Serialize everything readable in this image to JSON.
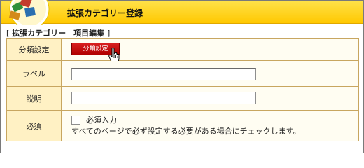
{
  "header": {
    "title": "拡張カテゴリー登録"
  },
  "section": {
    "title": "拡張カテゴリー　項目編集",
    "open_bracket": "[",
    "close_bracket": "]"
  },
  "form": {
    "category": {
      "label": "分類設定",
      "button_label": "分類設定"
    },
    "label_field": {
      "label": "ラベル",
      "value": ""
    },
    "description_field": {
      "label": "説明",
      "value": ""
    },
    "required": {
      "label": "必須",
      "checkbox_label": "必須入力",
      "checked": false,
      "description": "すべてのページで必ず設定する必要がある場合にチェックします。"
    }
  },
  "colors": {
    "accent": "#ffc800",
    "button": "#c00000",
    "label_bg": "#fff1c4"
  }
}
